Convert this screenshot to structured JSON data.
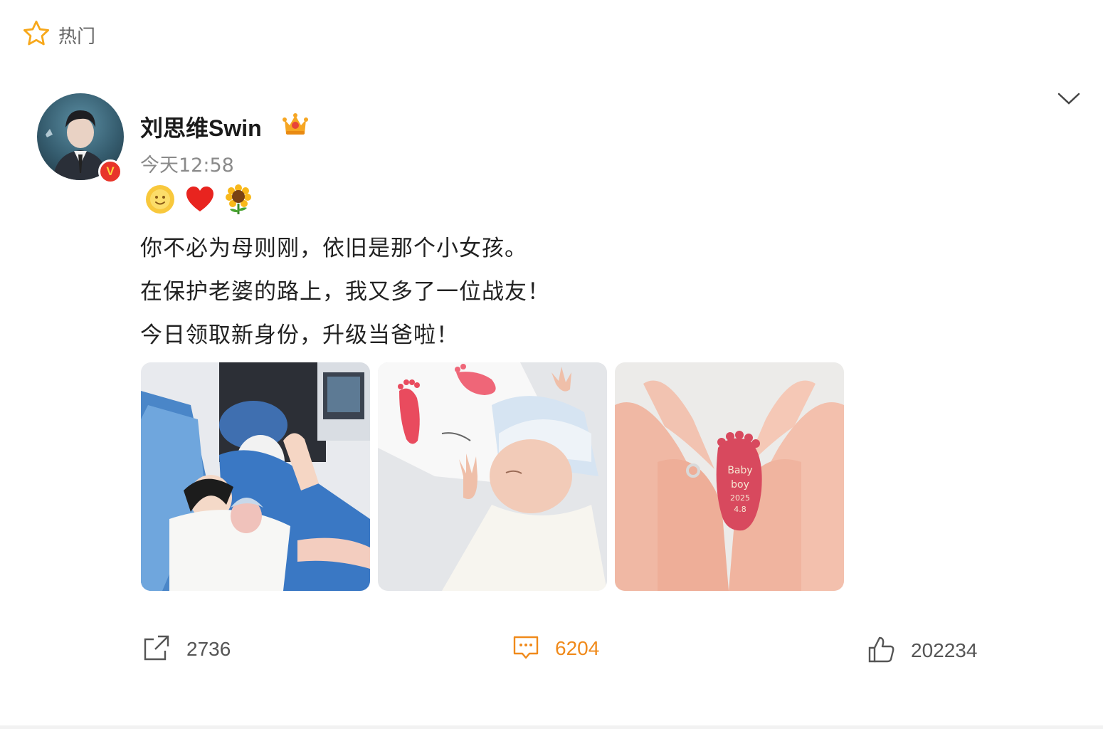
{
  "header": {
    "hot_label": "热门"
  },
  "post": {
    "username": "刘思维Swin",
    "time": "今天12:58",
    "emojis": [
      "smile-emoji",
      "heart-emoji",
      "sunflower-emoji"
    ],
    "lines": [
      "你不必为母则刚，依旧是那个小女孩。",
      "在保护老婆的路上，我又多了一位战友！",
      "今日领取新身份，升级当爸啦！"
    ],
    "images": [
      {
        "name": "photo-family-hospital"
      },
      {
        "name": "photo-newborn-footprint"
      },
      {
        "name": "photo-baby-foot-in-hands",
        "caption_lines": [
          "Baby",
          "boy",
          "2025",
          "4.8"
        ]
      }
    ],
    "actions": {
      "repost_count": "2736",
      "comment_count": "6204",
      "like_count": "202234"
    }
  },
  "colors": {
    "accent_orange": "#f08a1b",
    "star_yellow": "#f7a81b",
    "verified_red": "#e8352a"
  }
}
